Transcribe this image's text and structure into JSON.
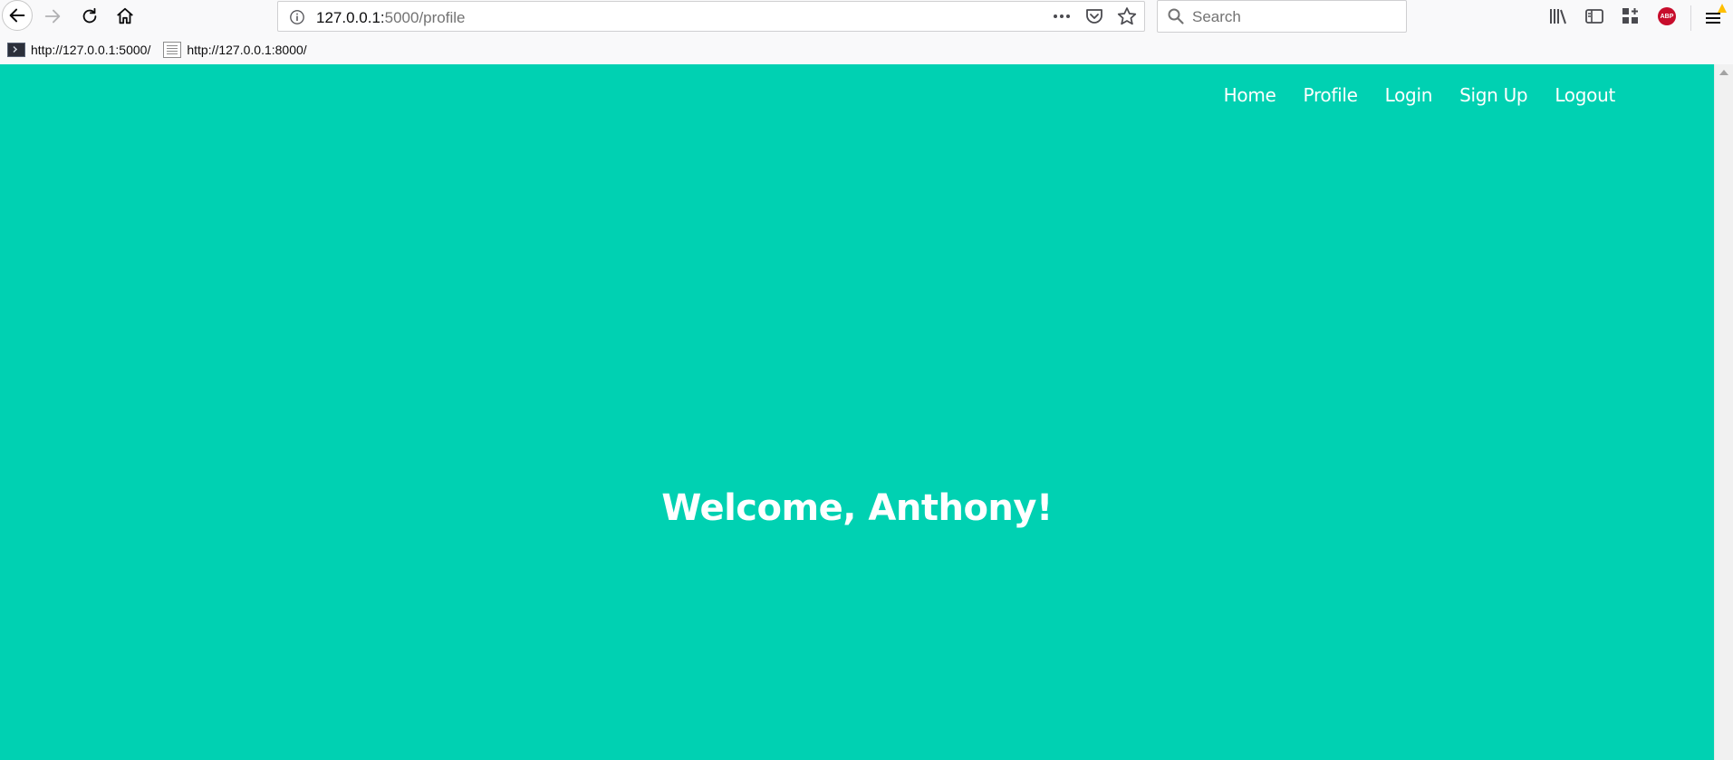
{
  "browser": {
    "url_host": "127.0.0.1:",
    "url_path": "5000/profile",
    "search_placeholder": "Search",
    "adblock_label": "ABP",
    "bookmarks": [
      {
        "label": "http://127.0.0.1:5000/",
        "icon": "terminal-icon"
      },
      {
        "label": "http://127.0.0.1:8000/",
        "icon": "page-icon"
      }
    ]
  },
  "colors": {
    "accent": "#00d1b2"
  },
  "site": {
    "nav": [
      "Home",
      "Profile",
      "Login",
      "Sign Up",
      "Logout"
    ],
    "welcome": "Welcome, Anthony!"
  }
}
